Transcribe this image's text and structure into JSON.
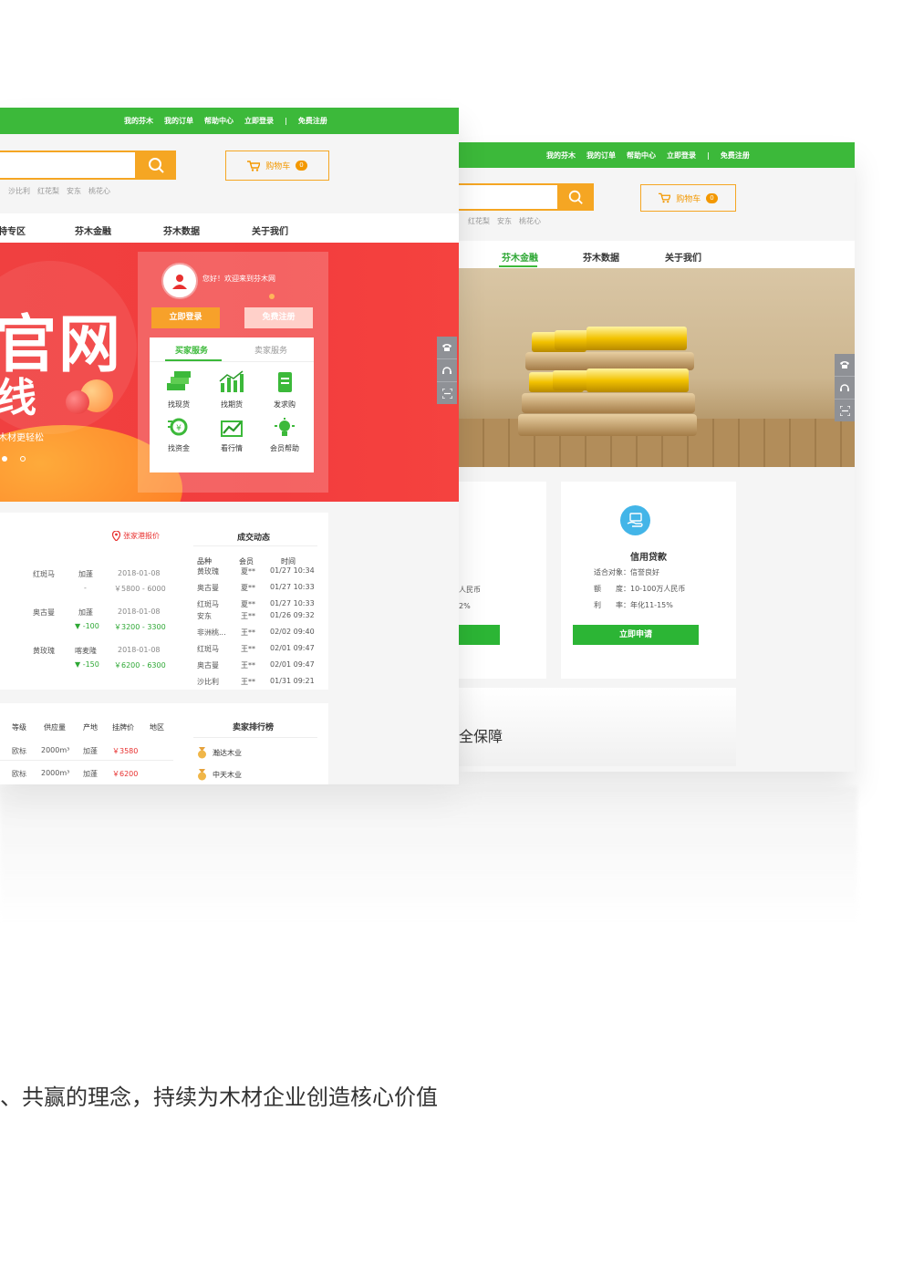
{
  "colors": {
    "green": "#3cb93a",
    "orange": "#f5a623",
    "red": "#e8302f",
    "banner_red": "#f23d3d"
  },
  "left_mockup": {
    "topbar_links": [
      "我的芬木",
      "我的订单",
      "帮助中心",
      "立即登录",
      "|",
      "免费注册"
    ],
    "cart_label": "购物车",
    "cart_count": "0",
    "hot_words": [
      "沙比利",
      "红花梨",
      "安东",
      "桃花心"
    ],
    "nav_items": [
      "特专区",
      "芬木金融",
      "芬木数据",
      "关于我们"
    ],
    "banner": {
      "big1": "官网",
      "big2": "线",
      "sub": "木材更轻松"
    },
    "welcome": "您好！欢迎来到芬木网",
    "login_btn": "立即登录",
    "register_btn": "免费注册",
    "service_tabs": [
      "买家服务",
      "卖家服务"
    ],
    "services": [
      "找现货",
      "找期货",
      "发求购",
      "找资金",
      "看行情",
      "会员帮助"
    ],
    "price_title": "张家港报价",
    "price_rows": [
      {
        "name": "红斑马",
        "place": "加蓬",
        "date": "2018-01-08",
        "change": "-",
        "price": "￥5800 - 6000"
      },
      {
        "name": "奥古曼",
        "place": "加蓬",
        "date": "2018-01-08",
        "change": "▼ -100",
        "price": "￥3200 - 3300"
      },
      {
        "name": "黄玫瑰",
        "place": "喀麦隆",
        "date": "2018-01-08",
        "change": "▼ -150",
        "price": "￥6200 - 6300"
      }
    ],
    "deals_title": "成交动态",
    "deals_headers": [
      "品种",
      "会员",
      "时间"
    ],
    "deals_rows": [
      {
        "a": "黄玫瑰",
        "b": "夏**",
        "c": "01/27 10:34"
      },
      {
        "a": "奥古曼",
        "b": "夏**",
        "c": "01/27 10:33"
      },
      {
        "a": "红斑马",
        "b": "夏**",
        "c": "01/27 10:33"
      },
      {
        "a": "安东",
        "b": "王**",
        "c": "01/26 09:32"
      },
      {
        "a": "非洲桃...",
        "b": "王**",
        "c": "02/02 09:40"
      },
      {
        "a": "红斑马",
        "b": "王**",
        "c": "02/01 09:47"
      },
      {
        "a": "奥古曼",
        "b": "王**",
        "c": "02/01 09:47"
      },
      {
        "a": "沙比利",
        "b": "王**",
        "c": "01/31 09:21"
      }
    ],
    "list_headers": [
      "等级",
      "供应量",
      "产地",
      "挂牌价",
      "地区"
    ],
    "list_rows": [
      {
        "grade": "欧标",
        "qty": "2000m³",
        "origin": "加蓬",
        "price": "￥3580"
      },
      {
        "grade": "欧标",
        "qty": "2000m³",
        "origin": "加蓬",
        "price": "￥6200"
      }
    ],
    "rank_title": "卖家排行榜",
    "rank_items": [
      "瀚达木业",
      "中天木业"
    ]
  },
  "right_mockup": {
    "topbar_links": [
      "我的芬木",
      "我的订单",
      "帮助中心",
      "立即登录",
      "|",
      "免费注册"
    ],
    "cart_label": "购物车",
    "cart_count": "0",
    "hot_words": [
      "红花梨",
      "安东",
      "桃花心"
    ],
    "nav_items": [
      "芬木金融",
      "芬木数据",
      "关于我们"
    ],
    "loan_title": "信用贷款",
    "loan_lines": [
      "适合对象：信誉良好",
      "额　　度：10-100万人民币",
      "利　　率：年化11-15%"
    ],
    "loan_btn": "立即申请",
    "left_card_lines": [
      "人民币",
      "2%"
    ],
    "security_title": "全保障"
  },
  "slogan": "、共赢的理念，持续为木材企业创造核心价值"
}
